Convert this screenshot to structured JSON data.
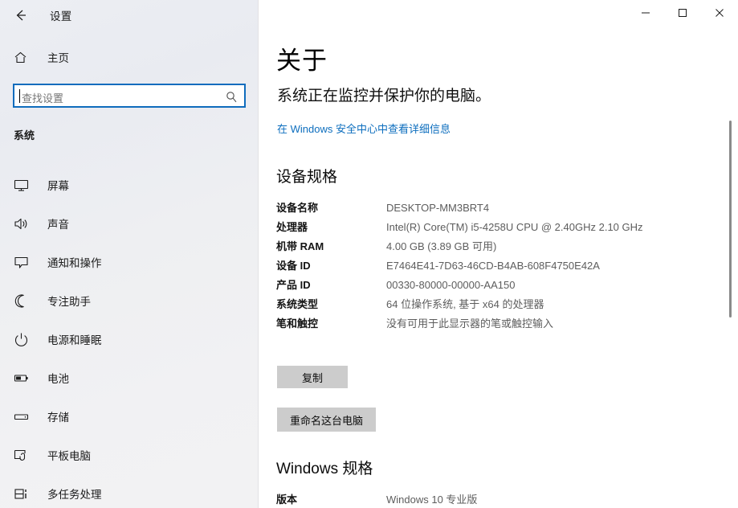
{
  "window": {
    "app_title": "设置",
    "back_icon": "back-arrow-icon",
    "controls": {
      "minimize": "minimize-icon",
      "maximize": "maximize-icon",
      "close": "close-icon"
    }
  },
  "sidebar": {
    "home_label": "主页",
    "home_icon": "home-icon",
    "search": {
      "placeholder": "查找设置",
      "value": "",
      "icon": "search-icon"
    },
    "section_title": "系统",
    "items": [
      {
        "label": "屏幕",
        "icon": "monitor-icon"
      },
      {
        "label": "声音",
        "icon": "speaker-icon"
      },
      {
        "label": "通知和操作",
        "icon": "chat-bubble-icon"
      },
      {
        "label": "专注助手",
        "icon": "moon-icon"
      },
      {
        "label": "电源和睡眠",
        "icon": "power-icon"
      },
      {
        "label": "电池",
        "icon": "battery-icon"
      },
      {
        "label": "存储",
        "icon": "drive-icon"
      },
      {
        "label": "平板电脑",
        "icon": "tablet-hand-icon"
      },
      {
        "label": "多任务处理",
        "icon": "multitasking-icon"
      }
    ]
  },
  "main": {
    "page_title": "关于",
    "subtitle": "系统正在监控并保护你的电脑。",
    "security_link": "在 Windows 安全中心中查看详细信息",
    "device_spec": {
      "heading": "设备规格",
      "rows": [
        {
          "label": "设备名称",
          "value": "DESKTOP-MM3BRT4"
        },
        {
          "label": "处理器",
          "value": "Intel(R) Core(TM) i5-4258U CPU @ 2.40GHz   2.10 GHz"
        },
        {
          "label": "机带 RAM",
          "value": "4.00 GB (3.89 GB 可用)"
        },
        {
          "label": "设备 ID",
          "value": "E7464E41-7D63-46CD-B4AB-608F4750E42A"
        },
        {
          "label": "产品 ID",
          "value": "00330-80000-00000-AA150"
        },
        {
          "label": "系统类型",
          "value": "64 位操作系统, 基于 x64 的处理器"
        },
        {
          "label": "笔和触控",
          "value": "没有可用于此显示器的笔或触控输入"
        }
      ],
      "copy_button": "复制",
      "rename_button": "重命名这台电脑"
    },
    "windows_spec": {
      "heading": "Windows 规格",
      "rows": [
        {
          "label": "版本",
          "value": "Windows 10 专业版"
        }
      ]
    }
  },
  "colors": {
    "accent_link": "#0d6ebe",
    "search_border": "#0f6cbd",
    "button_bg": "#cccccc",
    "value_text": "#5d5d5d"
  }
}
